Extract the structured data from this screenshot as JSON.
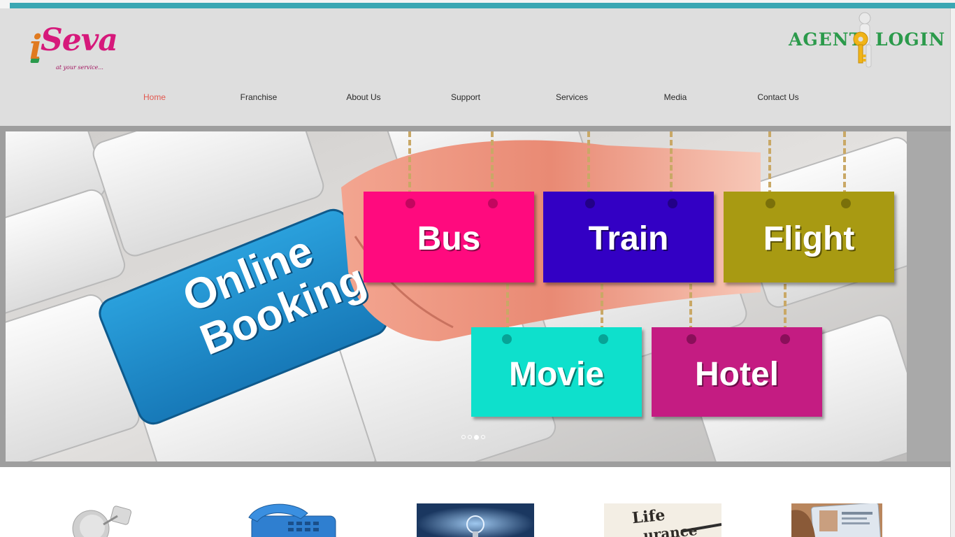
{
  "logo": {
    "letter": "i",
    "name": "Seva",
    "tagline": "at your service..."
  },
  "agent_login": {
    "left": "AGENT",
    "right": "LOGIN"
  },
  "nav": {
    "items": [
      {
        "label": "Home",
        "active": true
      },
      {
        "label": "Franchise",
        "active": false
      },
      {
        "label": "About Us",
        "active": false
      },
      {
        "label": "Support",
        "active": false
      },
      {
        "label": "Services",
        "active": false
      },
      {
        "label": "Media",
        "active": false
      },
      {
        "label": "Contact Us",
        "active": false
      }
    ]
  },
  "slide": {
    "key_text_line1": "Online",
    "key_text_line2": "Booking",
    "cards": [
      {
        "label": "Bus",
        "color": "#ff0a7e"
      },
      {
        "label": "Train",
        "color": "#3300c4"
      },
      {
        "label": "Flight",
        "color": "#a89a12"
      },
      {
        "label": "Movie",
        "color": "#0ee0cc"
      },
      {
        "label": "Hotel",
        "color": "#c41c82"
      }
    ],
    "active_dot": 3,
    "dot_count": 4
  },
  "thumbnails": [
    {
      "name": "dth-dish-image"
    },
    {
      "name": "telephone-image"
    },
    {
      "name": "lightbulb-image"
    },
    {
      "name": "life-insurance-image",
      "text_1": "Life",
      "text_2": "urance"
    },
    {
      "name": "id-card-image"
    }
  ],
  "colors": {
    "accent_teal": "#3aa7b3",
    "nav_active": "#e2584f",
    "brand_green": "#2b9a4b",
    "brand_pink": "#d6197b",
    "header_bg": "#dedede"
  }
}
